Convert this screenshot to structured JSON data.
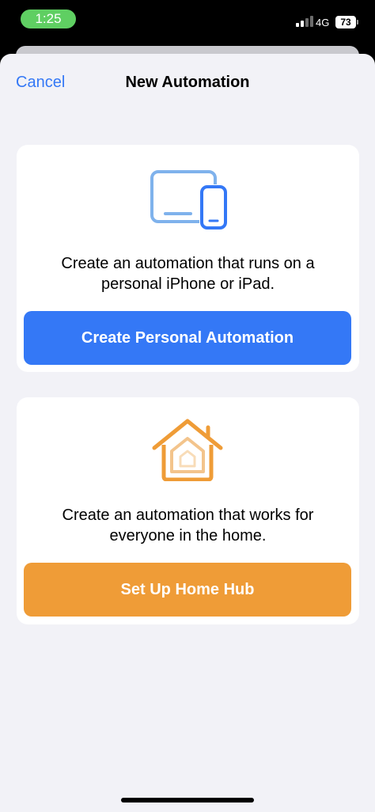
{
  "status_bar": {
    "time": "1:25",
    "network": "4G",
    "battery": "73",
    "time_pill_color": "#5fcf62"
  },
  "nav": {
    "cancel_label": "Cancel",
    "title": "New Automation"
  },
  "cards": {
    "personal": {
      "icon": "devices-icon",
      "description": "Create an automation that runs on a personal iPhone or iPad.",
      "button_label": "Create Personal Automation",
      "button_color": "#3478f6"
    },
    "home": {
      "icon": "home-icon",
      "description": "Create an automation that works for everyone in the home.",
      "button_label": "Set Up Home Hub",
      "button_color": "#ef9c37"
    }
  }
}
